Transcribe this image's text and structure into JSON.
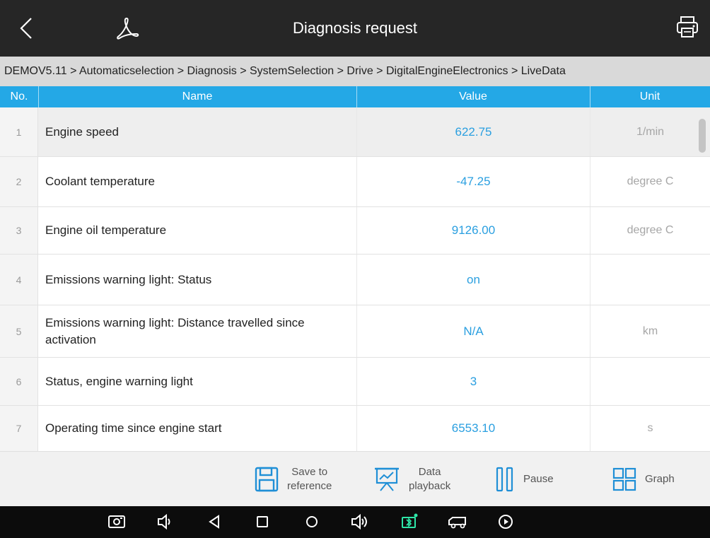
{
  "header": {
    "title": "Diagnosis request",
    "back_icon": "back-chevron-icon",
    "pdf_icon": "pdf-icon",
    "print_icon": "print-icon"
  },
  "breadcrumb": "DEMOV5.11 > Automaticselection > Diagnosis > SystemSelection > Drive > DigitalEngineElectronics > LiveData",
  "table": {
    "columns": [
      "No.",
      "Name",
      "Value",
      "Unit"
    ],
    "rows": [
      {
        "no": "1",
        "name": "Engine speed",
        "value": "622.75",
        "unit": "1/min",
        "selected": true
      },
      {
        "no": "2",
        "name": "Coolant temperature",
        "value": "-47.25",
        "unit": "degree C"
      },
      {
        "no": "3",
        "name": "Engine oil temperature",
        "value": "9126.00",
        "unit": "degree C"
      },
      {
        "no": "4",
        "name": "Emissions warning light: Status",
        "value": "on",
        "unit": ""
      },
      {
        "no": "5",
        "name": "Emissions warning light: Distance travelled since activation",
        "value": "N/A",
        "unit": "km"
      },
      {
        "no": "6",
        "name": "Status, engine warning light",
        "value": "3",
        "unit": ""
      },
      {
        "no": "7",
        "name": "Operating time since engine start",
        "value": "6553.10",
        "unit": "s"
      }
    ]
  },
  "toolbar": {
    "save_label_1": "Save to",
    "save_label_2": "reference",
    "playback_label_1": "Data",
    "playback_label_2": "playback",
    "pause_label": "Pause",
    "graph_label": "Graph"
  },
  "colors": {
    "accent": "#24a8e6",
    "value_text": "#2a9fe0",
    "titlebar": "#262626",
    "breadcrumb_bg": "#d9d9d9",
    "icon_blue": "#1f8fd6",
    "bluetooth_green": "#2ee6a8"
  }
}
